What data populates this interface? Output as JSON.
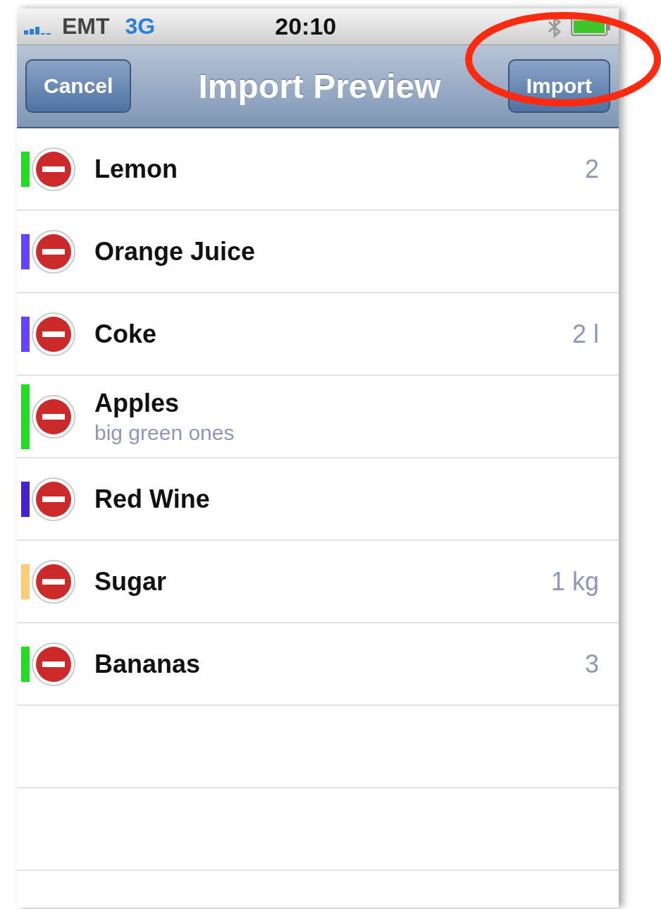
{
  "status_bar": {
    "carrier": "EMT",
    "network": "3G",
    "time": "20:10"
  },
  "nav_bar": {
    "left_button": "Cancel",
    "title": "Import Preview",
    "right_button": "Import",
    "right_button_circled": true
  },
  "items": [
    {
      "name": "Lemon",
      "quantity": "2",
      "color": "#22dd22"
    },
    {
      "name": "Orange Juice",
      "color": "#6644ff"
    },
    {
      "name": "Coke",
      "quantity": "2 l",
      "color": "#6644ff"
    },
    {
      "name": "Apples",
      "note": "big green ones",
      "color": "#22dd22"
    },
    {
      "name": "Red Wine",
      "color": "#4422cc"
    },
    {
      "name": "Sugar",
      "quantity": "1 kg",
      "color": "#ffcc77"
    },
    {
      "name": "Bananas",
      "quantity": "3",
      "color": "#22dd22"
    }
  ]
}
